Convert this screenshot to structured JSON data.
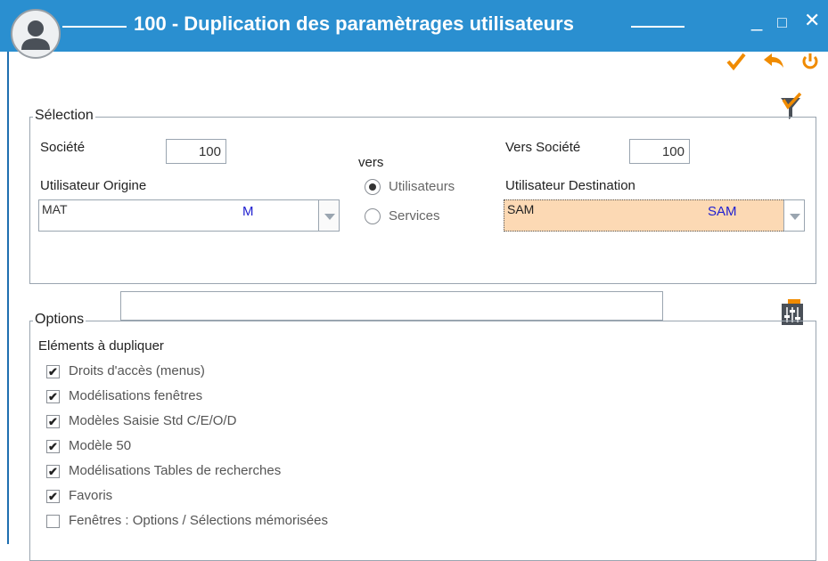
{
  "window": {
    "title": "100 - Duplication des paramètrages utilisateurs",
    "minimize_glyph": "_",
    "maximize_glyph": "□",
    "close_glyph": "✕"
  },
  "toolbar": {
    "validate_icon": "check-icon",
    "undo_icon": "undo-icon",
    "power_icon": "power-icon",
    "accent_color": "#f08b00"
  },
  "selection": {
    "legend": "Sélection",
    "societe_label": "Société",
    "societe_value": "100",
    "vers_label": "vers",
    "vers_societe_label": "Vers Société",
    "vers_societe_value": "100",
    "origine_label": "Utilisateur Origine",
    "origine_code": "MAT",
    "origine_name": "M",
    "destination_label": "Utilisateur Destination",
    "destination_code": "SAM",
    "destination_name": "SAM",
    "radio_utilisateurs": "Utilisateurs",
    "radio_services": "Services",
    "selected_radio": "Utilisateurs"
  },
  "options": {
    "legend": "Options",
    "search_value": "",
    "group_label": "Eléments à dupliquer",
    "items": [
      {
        "label": "Droits d'accès (menus)",
        "checked": true
      },
      {
        "label": "Modélisations fenêtres",
        "checked": true
      },
      {
        "label": "Modèles Saisie Std C/E/O/D",
        "checked": true
      },
      {
        "label": "Modèle 50",
        "checked": true
      },
      {
        "label": "Modélisations Tables de recherches",
        "checked": true
      },
      {
        "label": "Favoris",
        "checked": true
      },
      {
        "label": "Fenêtres : Options / Sélections mémorisées",
        "checked": false
      }
    ]
  }
}
